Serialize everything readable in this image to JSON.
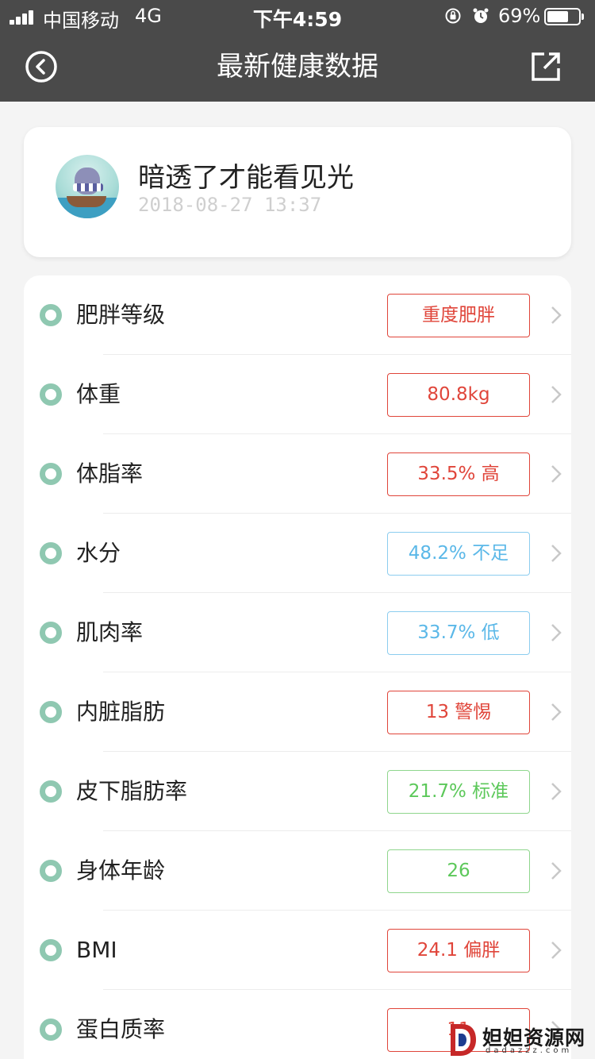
{
  "status_bar": {
    "carrier": "中国移动",
    "network": "4G",
    "time": "下午4:59",
    "battery_percent": "69%",
    "battery_level": 0.69
  },
  "nav": {
    "title": "最新健康数据",
    "back_icon": "back-circle-icon",
    "share_icon": "share-icon"
  },
  "profile": {
    "name": "暗透了才能看见光",
    "datetime": "2018-08-27 13:37"
  },
  "colors": {
    "header_bg": "#4a4a4a",
    "dot": "#8fc8b1",
    "red": "#e0453a",
    "blue": "#5bb8e8",
    "green": "#5cc85a"
  },
  "metrics": [
    {
      "label": "肥胖等级",
      "value": "重度肥胖",
      "status": "red"
    },
    {
      "label": "体重",
      "value": "80.8kg",
      "status": "red"
    },
    {
      "label": "体脂率",
      "value": "33.5% 高",
      "status": "red"
    },
    {
      "label": "水分",
      "value": "48.2% 不足",
      "status": "blue"
    },
    {
      "label": "肌肉率",
      "value": "33.7% 低",
      "status": "blue"
    },
    {
      "label": "内脏脂肪",
      "value": "13 警惕",
      "status": "red"
    },
    {
      "label": "皮下脂肪率",
      "value": "21.7% 标准",
      "status": "green"
    },
    {
      "label": "身体年龄",
      "value": "26",
      "status": "green"
    },
    {
      "label": "BMI",
      "value": "24.1 偏胖",
      "status": "red"
    },
    {
      "label": "蛋白质率",
      "value": "11",
      "status": "red"
    }
  ],
  "watermark": {
    "text": "妲妲资源网",
    "sub": "dadazzz.com"
  }
}
